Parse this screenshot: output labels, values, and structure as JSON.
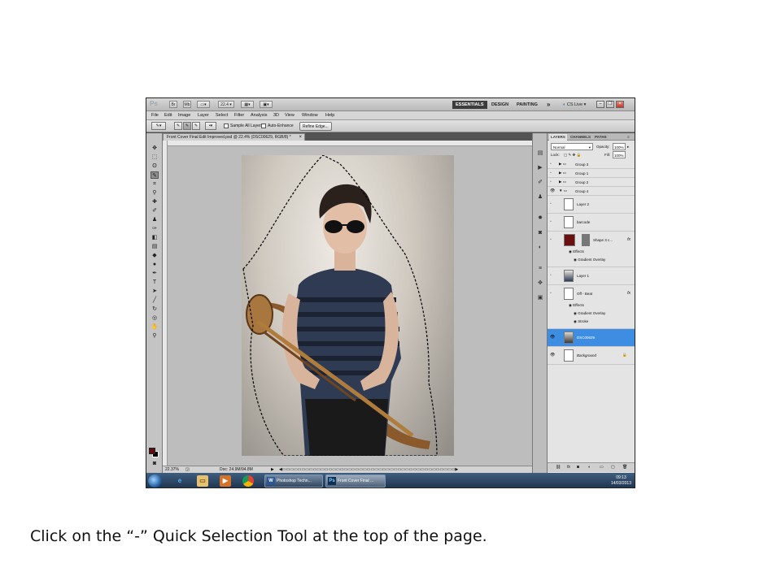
{
  "app": {
    "logo": "Ps",
    "zoom": "22.4",
    "workspaces": [
      "ESSENTIALS",
      "DESIGN",
      "PAINTING"
    ],
    "more": "»",
    "cs_live": "CS Live"
  },
  "menu": [
    "File",
    "Edit",
    "Image",
    "Layer",
    "Select",
    "Filter",
    "Analysis",
    "3D",
    "View",
    "Window",
    "Help"
  ],
  "options": {
    "sample_all_layers": "Sample All Layers",
    "auto_enhance": "Auto-Enhance",
    "refine_edge": "Refine Edge..."
  },
  "document": {
    "tab_title": "Front Cover Final Edit Improved.psd @ 22.4% (DSC00629, RGB/8) *",
    "close": "×",
    "status_zoom": "22.37%",
    "doc_size": "Doc: 24.9M/94.8M"
  },
  "panel": {
    "tabs": [
      "LAYERS",
      "CHANNELS",
      "PATHS"
    ],
    "blend_mode": "Normal",
    "opacity_label": "Opacity:",
    "opacity_value": "100%",
    "lock_label": "Lock:",
    "fill_label": "Fill:",
    "fill_value": "100%",
    "layers": [
      {
        "name": "Group 3"
      },
      {
        "name": "Group 1"
      },
      {
        "name": "Group 2"
      },
      {
        "name": "Group 4"
      },
      {
        "name": "Layer 2"
      },
      {
        "name": "barcode"
      },
      {
        "name": "Shape 3 c..."
      },
      {
        "name": "Effects"
      },
      {
        "name": "Gradient Overlay"
      },
      {
        "name": "Layer 1"
      },
      {
        "name": "Off - Beat"
      },
      {
        "name": "Effects"
      },
      {
        "name": "Gradient Overlay"
      },
      {
        "name": "Stroke"
      },
      {
        "name": "DSC00629"
      },
      {
        "name": "Background"
      }
    ],
    "fx": "fx"
  },
  "taskbar": {
    "items": [
      "Photoshop Techn...",
      "Front Cover Final ..."
    ],
    "time": "09:13",
    "date": "14/03/2013"
  },
  "caption": "Click on the “-” Quick Selection Tool at the top of the page.",
  "colors": {
    "selected_layer": "#3d8ee3",
    "foreground_swatch": "#5a0f0f",
    "taskbar": "#1d324c"
  }
}
